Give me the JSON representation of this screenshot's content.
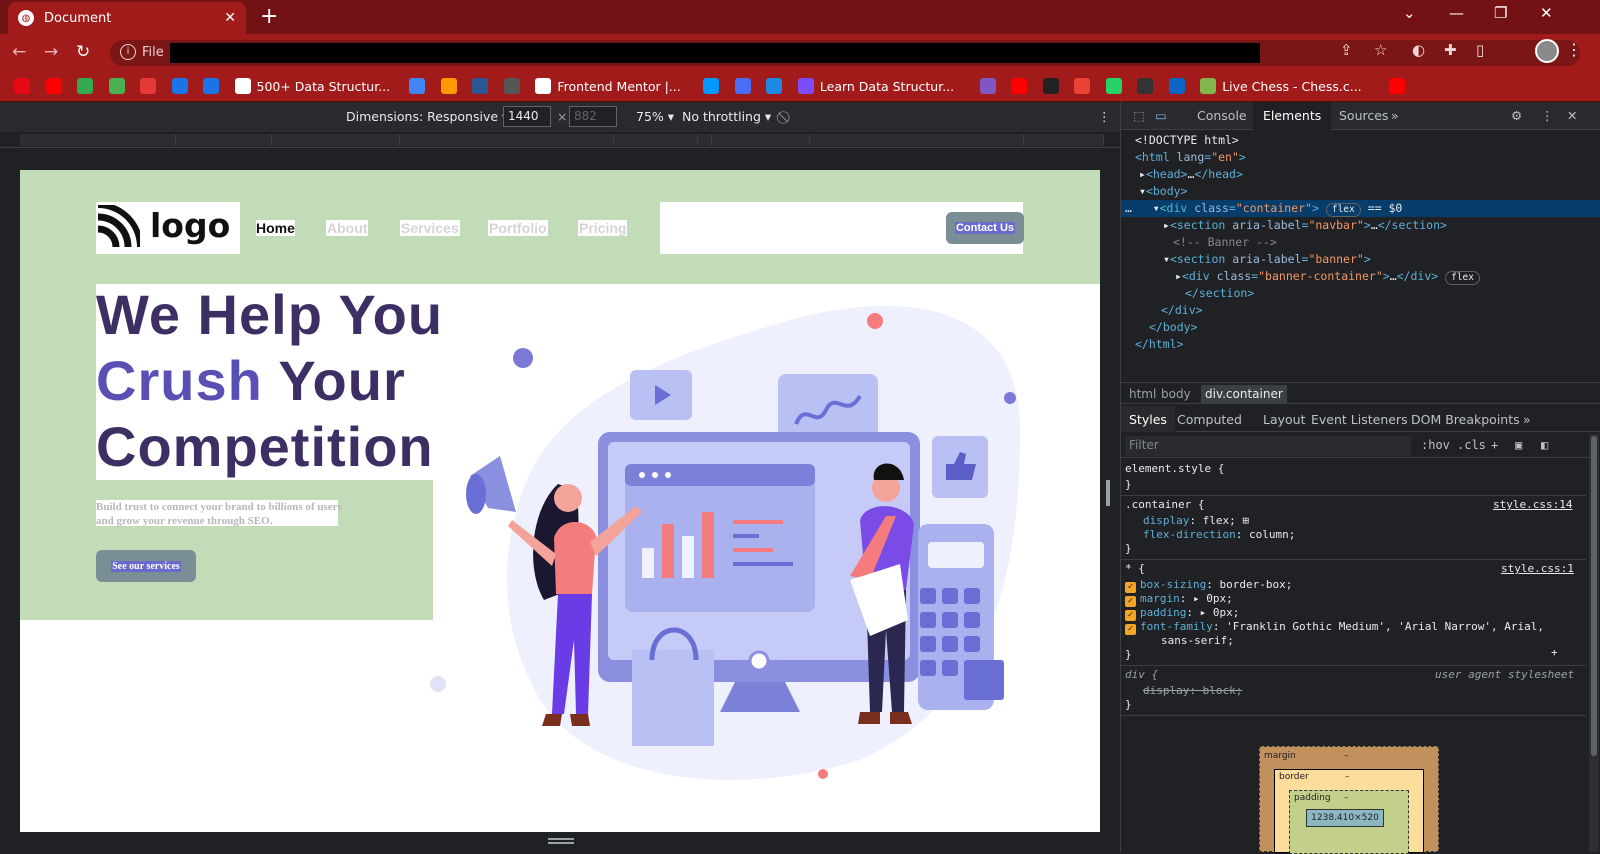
{
  "browser": {
    "tab_title": "Document",
    "address_scheme": "File",
    "bookmarks": [
      {
        "label": "",
        "color": "#e50914"
      },
      {
        "label": "",
        "color": "#ff0000"
      },
      {
        "label": "",
        "color": "#34a853"
      },
      {
        "label": "",
        "color": "#4caf50"
      },
      {
        "label": "",
        "color": "#e53935"
      },
      {
        "label": "",
        "color": "#1a73e8"
      },
      {
        "label": "",
        "color": "#1a73e8"
      },
      {
        "label": "500+ Data Structur...",
        "color": "#ffffff"
      },
      {
        "label": "",
        "color": "#4285f4"
      },
      {
        "label": "",
        "color": "#ff9900"
      },
      {
        "label": "",
        "color": "#2b5797"
      },
      {
        "label": "",
        "color": "#555555"
      },
      {
        "label": "Frontend Mentor |...",
        "color": "#ffffff"
      },
      {
        "label": "",
        "color": "#0098ff"
      },
      {
        "label": "",
        "color": "#4a6cf7"
      },
      {
        "label": "",
        "color": "#1e88e5"
      },
      {
        "label": "Learn Data Structur...",
        "color": "#7c4dff"
      },
      {
        "label": "",
        "color": "#7e57c2"
      },
      {
        "label": "",
        "color": "#ff0000"
      },
      {
        "label": "",
        "color": "#222222"
      },
      {
        "label": "",
        "color": "#ea4335"
      },
      {
        "label": "",
        "color": "#25d366"
      },
      {
        "label": "",
        "color": "#333333"
      },
      {
        "label": "",
        "color": "#0a66c2"
      },
      {
        "label": "Live Chess - Chess.c...",
        "color": "#81b64c"
      },
      {
        "label": "",
        "color": "#ff0000"
      }
    ]
  },
  "device_toolbar": {
    "dimensions_label": "Dimensions: Responsive",
    "width_value": "1440",
    "height_placeholder": "882",
    "times": "×",
    "zoom": "75%",
    "throttling": "No throttling"
  },
  "site": {
    "logo_text": "logo",
    "nav": [
      "Home",
      "About",
      "Services",
      "Portfolio",
      "Pricing"
    ],
    "contact_label": "Contact Us",
    "heading_line1": "We Help You",
    "heading_accent": "Crush",
    "heading_line2_rest": " Your",
    "heading_line3": "Competition",
    "subtext": "Build trust to connect your brand to billions of users and grow your revenue through SEO.",
    "cta_label": "See our services"
  },
  "devtools": {
    "tabs": [
      "Console",
      "Elements",
      "Sources",
      "»"
    ],
    "breadcrumbs": [
      "html",
      "body",
      "div.container"
    ],
    "styles_tabs": [
      "Styles",
      "Computed",
      "Layout",
      "Event Listeners",
      "DOM Breakpoints",
      "»"
    ],
    "filter_placeholder": "Filter",
    "hov": ":hov",
    "cls": ".cls",
    "box_model": {
      "margin_label": "margin",
      "border_label": "border",
      "padding_label": "padding",
      "dash": "–",
      "content_size": "1238.410×520"
    }
  }
}
